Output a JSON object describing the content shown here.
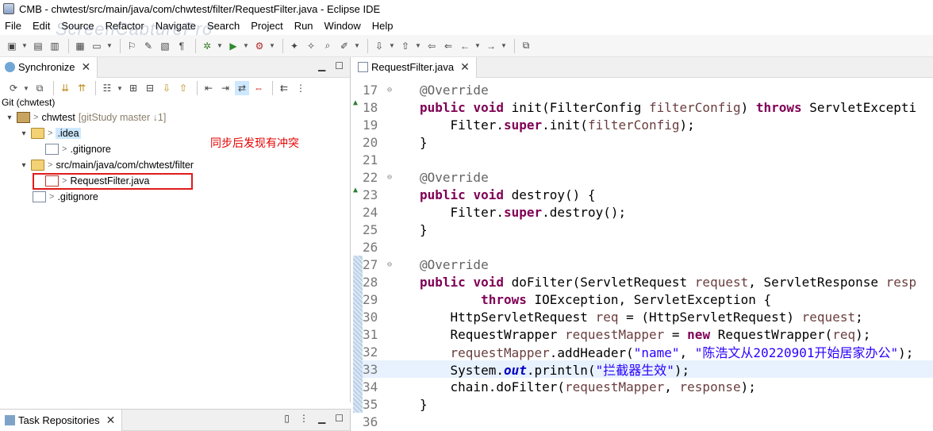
{
  "window": {
    "title": "CMB - chwtest/src/main/java/com/chwtest/filter/RequestFilter.java - Eclipse IDE"
  },
  "menu": [
    "File",
    "Edit",
    "Source",
    "Refactor",
    "Navigate",
    "Search",
    "Project",
    "Run",
    "Window",
    "Help"
  ],
  "watermark": "ScreenCapturePro",
  "left_view": {
    "tab_label": "Synchronize",
    "sync_label": "Git (chwtest)",
    "tree": [
      {
        "name": "chwtest",
        "meta": "[gitStudy master ↓1]",
        "twist": "▾",
        "prefix": ">"
      },
      {
        "name": ".idea",
        "twist": "▾",
        "prefix": ">"
      },
      {
        "name": ".gitignore",
        "prefix": ">"
      },
      {
        "name": "src/main/java/com/chwtest/filter",
        "twist": "▾",
        "prefix": ">"
      },
      {
        "name": "RequestFilter.java",
        "prefix": ">"
      },
      {
        "name": ".gitignore",
        "prefix": ">"
      }
    ],
    "annotation": "同步后发现有冲突"
  },
  "task_view": {
    "tab_label": "Task Repositories"
  },
  "editor": {
    "tab_label": "RequestFilter.java",
    "line_numbers": [
      "17",
      "18",
      "19",
      "20",
      "21",
      "22",
      "23",
      "24",
      "25",
      "26",
      "27",
      "28",
      "29",
      "30",
      "31",
      "32",
      "33",
      "34",
      "35",
      "36"
    ],
    "t": {
      "override": "@Override",
      "public": "public",
      "void": "void",
      "init_sig": " init(FilterConfig ",
      "filterConfig": "filterConfig",
      "close_paren": ") ",
      "throws": "throws",
      "servlet_exc": " ServletExcepti",
      "filter_dot": "Filter.",
      "super": "super",
      "init_call": ".init(",
      "init_end": ");",
      "brace_close": "}",
      "destroy_sig": " destroy() {",
      "destroy_call": ".destroy();",
      "dofilter_sig": " doFilter(ServletRequest ",
      "request": "request",
      "comma_sr": ", ServletResponse ",
      "resp": "resp",
      "throws_rest": " IOException, ServletException {",
      "l30a": "HttpServletRequest ",
      "req": "req",
      "l30b": " = (HttpServletRequest) ",
      "semi": ";",
      "l31a": "RequestWrapper ",
      "requestMapper": "requestMapper",
      "eq": " = ",
      "new": "new",
      "l31b": " RequestWrapper(",
      "l31c": ");",
      "l32a": ".addHeader(",
      "str_name": "\"name\"",
      "comma": ", ",
      "str_val": "\"陈浩文从20220901开始居家办公\"",
      "l33a": "System.",
      "out": "out",
      "l33b": ".println(",
      "str_msg": "\"拦截器生效\"",
      "l34a": "chain.doFilter(",
      "response": "response"
    }
  },
  "colors": {
    "keyword": "#7f0055",
    "string": "#2a00ff",
    "annotation": "#646464",
    "param": "#6a3e3e",
    "field": "#0000c0",
    "highlight_box": "#e01b1b",
    "annotation_text": "#e60000"
  }
}
